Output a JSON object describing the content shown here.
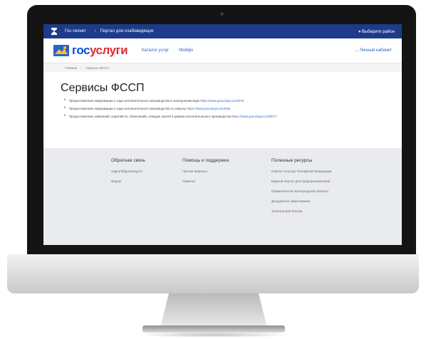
{
  "topbar": {
    "crumb_1": "Гос-тепнет",
    "crumb_2": "Портал для слабовидящих",
    "region": "Выберите район"
  },
  "header": {
    "brand_part1": "гос",
    "brand_part2": "услуги",
    "nav": [
      "Каталог услуг",
      "Мойфо"
    ],
    "cabinet": "Личный кабинет"
  },
  "breadcrumb": [
    "Главная",
    "Сервисы ФССП"
  ],
  "main": {
    "title": "Сервисы ФССП",
    "items": [
      {
        "text": "Предоставление информации о ходе исполнительного производства в электронном виде",
        "link": "https://www.gosuslugi.ru/10076"
      },
      {
        "text": "Предоставление информации о ходе исполнительного производства по запросу",
        "link": "https://www.gosuslugi.ru/10093"
      },
      {
        "text": "Предоставление заявлений, ходатайств, объяснений, отводов, жалоб в рамках исполнительного производства",
        "link": "https://www.gosuslugi.ru/100077"
      }
    ]
  },
  "footer": {
    "columns": [
      {
        "heading": "Обратная связь",
        "items": [
          "support@gosuslugi.ru",
          "Форум"
        ]
      },
      {
        "heading": "Помощь и поддержка",
        "items": [
          "Частые вопросы",
          "Памятка"
        ]
      },
      {
        "heading": "Полезные ресурсы",
        "items": [
          "Портал Госуслуг Российской Федерации",
          "Единый портал для предпринимателей",
          "Правительство Белгородской области",
          "Досудебное обжалование",
          "Электронная Россия"
        ]
      }
    ]
  },
  "colors": {
    "topbar": "#1d3b8a",
    "brand_blue": "#0d4cd3",
    "brand_red": "#e02c2c",
    "footer_bg": "#e9ebee"
  }
}
